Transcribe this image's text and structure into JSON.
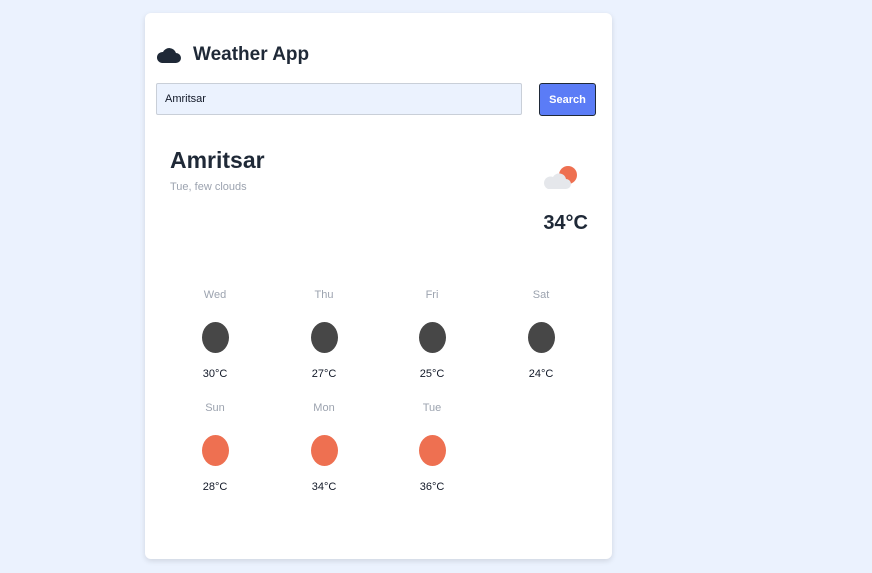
{
  "app": {
    "title": "Weather App",
    "icon": "cloud-icon"
  },
  "search": {
    "value": "Amritsar",
    "button_label": "Search"
  },
  "current": {
    "city": "Amritsar",
    "description": "Tue, few clouds",
    "temperature": "34°C",
    "icon": "sun-behind-cloud-icon"
  },
  "forecast": [
    {
      "day": "Wed",
      "temp": "30°C",
      "icon": "dark-circle-icon",
      "color": "#474747"
    },
    {
      "day": "Thu",
      "temp": "27°C",
      "icon": "dark-circle-icon",
      "color": "#474747"
    },
    {
      "day": "Fri",
      "temp": "25°C",
      "icon": "dark-circle-icon",
      "color": "#474747"
    },
    {
      "day": "Sat",
      "temp": "24°C",
      "icon": "dark-circle-icon",
      "color": "#474747"
    },
    {
      "day": "Sun",
      "temp": "28°C",
      "icon": "sun-icon",
      "color": "#ee7051"
    },
    {
      "day": "Mon",
      "temp": "34°C",
      "icon": "sun-icon",
      "color": "#ee7051"
    },
    {
      "day": "Tue",
      "temp": "36°C",
      "icon": "sun-icon",
      "color": "#ee7051"
    }
  ],
  "colors": {
    "page_background": "#ebf2fe",
    "accent": "#5b7cf6",
    "sun": "#ee7051"
  }
}
